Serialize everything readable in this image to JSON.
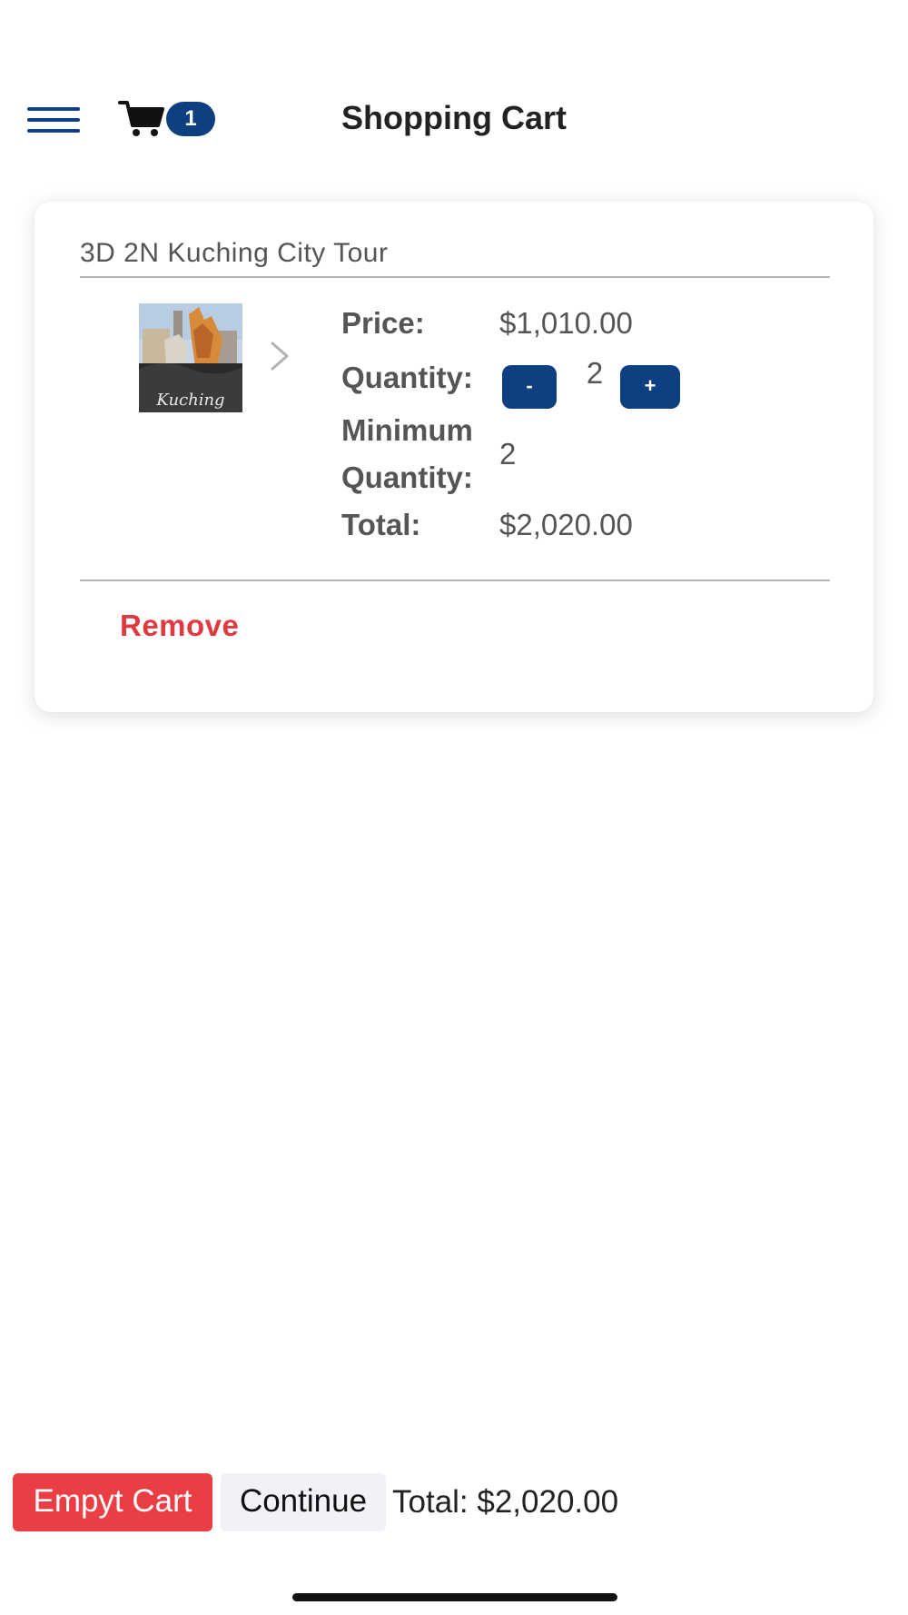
{
  "header": {
    "title": "Shopping Cart",
    "cart_count": "1",
    "menu_icon": "hamburger-menu-icon",
    "cart_icon": "shopping-cart-icon",
    "accent_color": "#0e3f80"
  },
  "cart_item": {
    "name": "3D 2N Kuching City Tour",
    "thumbnail_caption": "Kuching",
    "labels": {
      "price": "Price:",
      "quantity": "Quantity:",
      "minimum_line1": "Minimum",
      "minimum_line2": "Quantity:",
      "total": "Total:"
    },
    "price": "$1,010.00",
    "quantity": "2",
    "decrement_label": "-",
    "increment_label": "+",
    "minimum_quantity": "2",
    "total": "$2,020.00",
    "remove_label": "Remove"
  },
  "footer": {
    "empty_label": "Empyt Cart",
    "continue_label": "Continue",
    "total_text": "Total: $2,020.00",
    "danger_color": "#ea3e45"
  }
}
